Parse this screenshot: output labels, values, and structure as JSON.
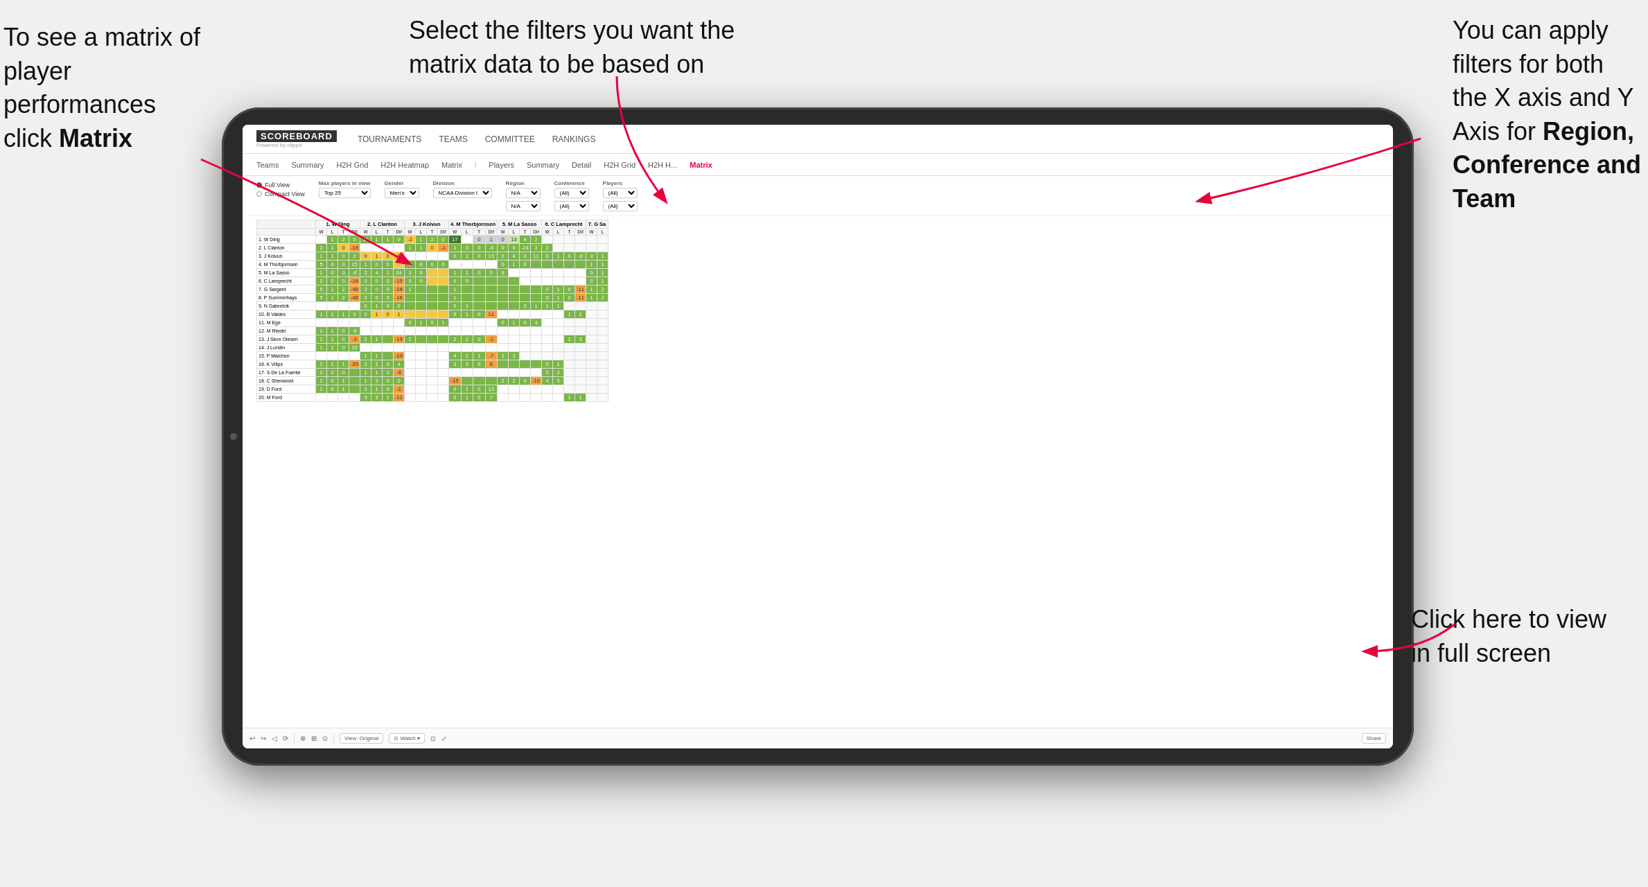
{
  "annotations": {
    "top_left": {
      "line1": "To see a matrix of",
      "line2": "player performances",
      "line3_prefix": "click ",
      "line3_bold": "Matrix"
    },
    "top_center": {
      "line1": "Select the filters you want the",
      "line2": "matrix data to be based on"
    },
    "top_right": {
      "line1": "You  can apply",
      "line2": "filters for both",
      "line3": "the X axis and Y",
      "line4_prefix": "Axis for ",
      "line4_bold": "Region,",
      "line5_bold": "Conference and",
      "line6_bold": "Team"
    },
    "bottom_right": {
      "line1": "Click here to view",
      "line2": "in full screen"
    }
  },
  "app": {
    "logo": "SCOREBOARD",
    "logo_sub": "Powered by clippd",
    "nav": [
      "TOURNAMENTS",
      "TEAMS",
      "COMMITTEE",
      "RANKINGS"
    ],
    "sub_nav": [
      "Teams",
      "Summary",
      "H2H Grid",
      "H2H Heatmap",
      "Matrix",
      "Players",
      "Summary",
      "Detail",
      "H2H Grid",
      "H2H H...",
      "Matrix"
    ],
    "active_tab": "Matrix"
  },
  "filters": {
    "view_options": [
      "Full View",
      "Compact View"
    ],
    "selected_view": "Full View",
    "max_players_label": "Max players in view",
    "max_players_value": "Top 25",
    "gender_label": "Gender",
    "gender_value": "Men's",
    "division_label": "Division",
    "division_value": "NCAA Division I",
    "region_label": "Region",
    "region_value": "N/A",
    "conference_label": "Conference",
    "conference_value": "(All)",
    "conference_value2": "(All)",
    "players_label": "Players",
    "players_value": "(All)",
    "players_value2": "(All)"
  },
  "matrix": {
    "col_headers": [
      "1. W Ding",
      "2. L Clanton",
      "3. J Koivun",
      "4. M Thorbjornsen",
      "5. M La Sasso",
      "6. C Lamprecht",
      "7. G Sa"
    ],
    "sub_cols": [
      "W",
      "L",
      "T",
      "Dif"
    ],
    "rows": [
      {
        "name": "1. W Ding",
        "cells": [
          {
            "t": "",
            "bg": "white"
          },
          {
            "t": "1",
            "bg": "green"
          },
          {
            "t": "2",
            "bg": "green"
          },
          {
            "t": "0",
            "bg": "green"
          },
          {
            "t": "11",
            "bg": "green"
          },
          {
            "t": "1",
            "bg": "green"
          },
          {
            "t": "1",
            "bg": "green"
          },
          {
            "t": "0",
            "bg": "green"
          },
          {
            "t": "-2",
            "bg": "yellow"
          },
          {
            "t": "1",
            "bg": "green"
          },
          {
            "t": "2",
            "bg": "green"
          },
          {
            "t": "0",
            "bg": "green"
          },
          {
            "t": "17",
            "bg": "green"
          },
          {
            "t": "",
            "bg": "white"
          },
          {
            "t": "0",
            "bg": "gray"
          },
          {
            "t": "1",
            "bg": "gray"
          },
          {
            "t": "0",
            "bg": "gray"
          },
          {
            "t": "13",
            "bg": "green-light"
          },
          {
            "t": "9",
            "bg": "green"
          },
          {
            "t": "2",
            "bg": "green"
          }
        ]
      },
      {
        "name": "2. L Clanton",
        "cells": []
      },
      {
        "name": "3. J Koivun",
        "cells": []
      },
      {
        "name": "4. M Thorbjornsen",
        "cells": []
      },
      {
        "name": "5. M La Sasso",
        "cells": []
      },
      {
        "name": "6. C Lamprecht",
        "cells": []
      },
      {
        "name": "7. G Sargent",
        "cells": []
      },
      {
        "name": "8. P Summerhays",
        "cells": []
      },
      {
        "name": "9. N Gabrelcik",
        "cells": []
      },
      {
        "name": "10. B Valdes",
        "cells": []
      },
      {
        "name": "11. M Ege",
        "cells": []
      },
      {
        "name": "12. M Riedel",
        "cells": []
      },
      {
        "name": "13. J Skov Olesen",
        "cells": []
      },
      {
        "name": "14. J Lundin",
        "cells": []
      },
      {
        "name": "15. P Maichon",
        "cells": []
      },
      {
        "name": "16. K Vilips",
        "cells": []
      },
      {
        "name": "17. S De La Fuente",
        "cells": []
      },
      {
        "name": "18. C Sherwood",
        "cells": []
      },
      {
        "name": "19. D Ford",
        "cells": []
      },
      {
        "name": "20. M Ford",
        "cells": []
      }
    ]
  },
  "toolbar": {
    "view_original": "View: Original",
    "watch": "Watch",
    "share": "Share"
  }
}
